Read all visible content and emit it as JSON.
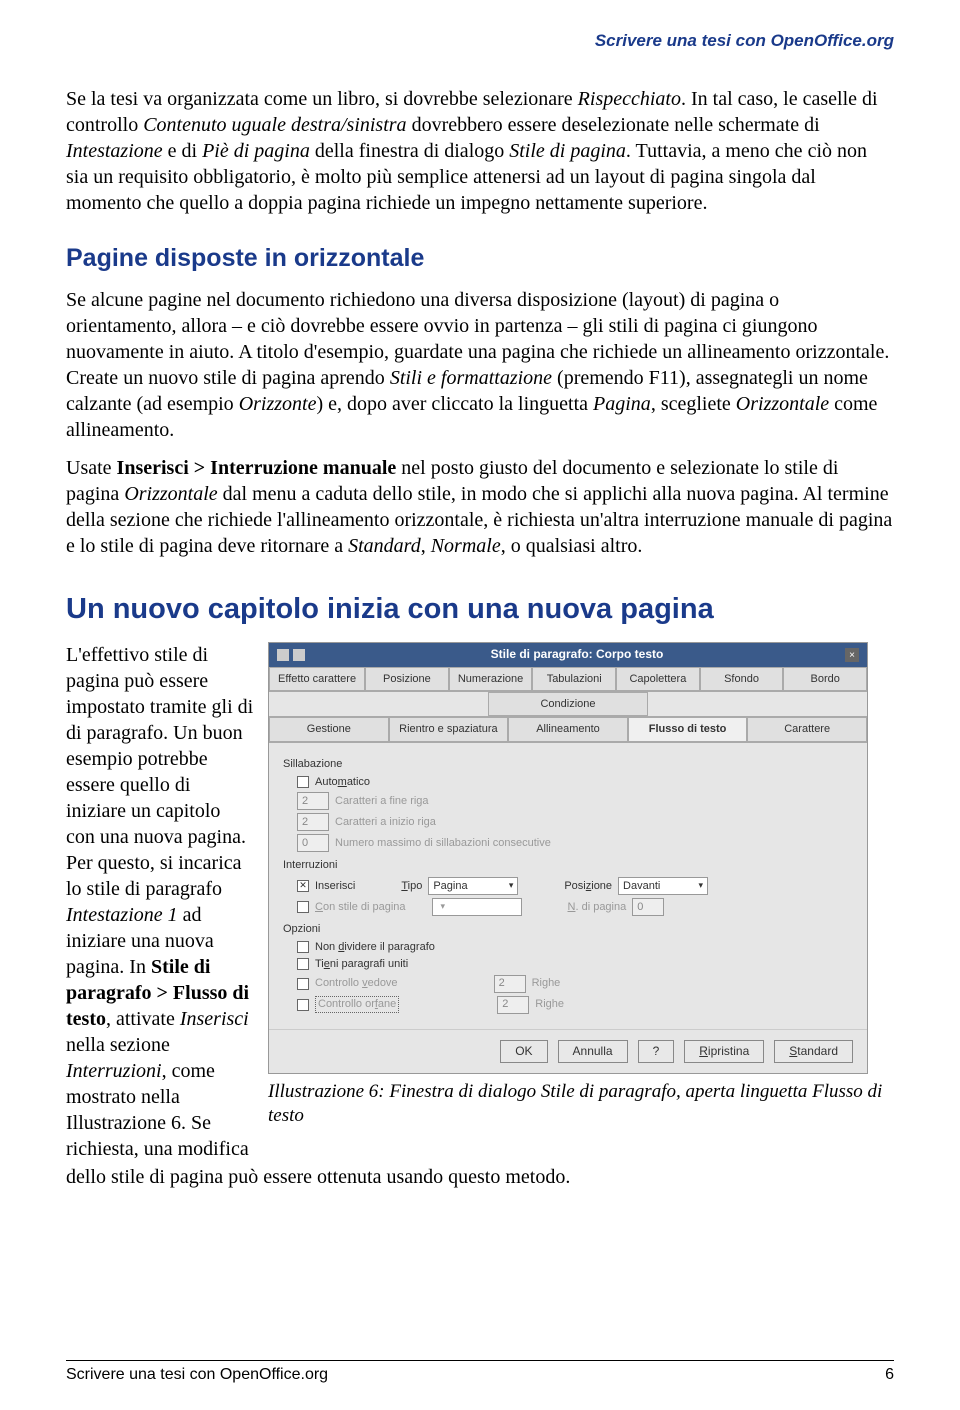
{
  "header": "Scrivere una tesi con OpenOffice.org",
  "p1a": "Se la tesi va organizzata come un libro, si dovrebbe selezionare ",
  "p1b": "Rispecchiato",
  "p1c": ". In tal caso, le caselle di controllo ",
  "p1d": "Contenuto uguale destra/sinistra",
  "p1e": " dovrebbero essere deselezionate nelle schermate di ",
  "p1f": "Intestazione",
  "p1g": " e di ",
  "p1h": "Piè di pagina",
  "p1i": " della finestra di dialogo ",
  "p1j": "Stile di pagina",
  "p1k": ". Tuttavia, a meno che ciò non sia  un requisito obbligatorio, è molto più semplice attenersi ad un layout di pagina singola dal momento che quello a doppia pagina richiede un impegno nettamente superiore.",
  "h2": "Pagine disposte in orizzontale",
  "p2a": "Se alcune pagine nel documento richiedono una diversa disposizione (layout) di pagina o orientamento, allora – e ciò dovrebbe essere ovvio in partenza – gli stili di pagina ci giungono nuovamente in aiuto. A titolo d'esempio, guardate una pagina che richiede un allineamento orizzontale. Create un nuovo stile di pagina aprendo ",
  "p2b": "Stili e formattazione",
  "p2c": " (premendo F11), assegnategli un nome calzante (ad esempio ",
  "p2d": "Orizzonte",
  "p2e": ") e, dopo aver cliccato la linguetta ",
  "p2f": "Pagina",
  "p2g": ", scegliete ",
  "p2h": "Orizzontale",
  "p2i": " come allineamento.",
  "p3a": "Usate ",
  "p3b": "Inserisci > Interruzione manuale",
  "p3c": " nel posto giusto del documento e selezionate lo stile di pagina ",
  "p3d": "Orizzontale",
  "p3e": " dal menu a caduta dello stile, in modo che si applichi alla nuova pagina. Al termine della sezione che richiede l'allineamento orizzontale, è richiesta un'altra interruzione manuale di pagina e lo stile di pagina deve ritornare a ",
  "p3f": "Standard",
  "p3g": ", ",
  "p3h": "Normale",
  "p3i": ", o qualsiasi altro.",
  "h1": "Un nuovo capitolo inizia con una nuova pagina",
  "leftcol_a": "L'effettivo stile di pagina può essere impostato tramite gli di di paragrafo. Un buon esempio potrebbe essere quello di iniziare un capitolo con una nuova pagina. Per questo,  si incarica lo stile di paragrafo ",
  "leftcol_b": "Intestazione 1",
  "leftcol_c": " ad iniziare una nuova pagina. In ",
  "leftcol_d": "Stile di paragrafo > Flusso di testo",
  "leftcol_e": ", attivate ",
  "leftcol_f": "Inserisci",
  "leftcol_g": " nella sezione ",
  "leftcol_h": "Interruzioni",
  "leftcol_i": ", come mostrato nella Illustrazione 6.  Se richiesta, una modifica",
  "after": "dello stile di pagina può essere ottenuta usando questo metodo.",
  "dialog": {
    "title": "Stile di paragrafo: Corpo testo",
    "tabs_row1": [
      "Effetto carattere",
      "Posizione",
      "Numerazione",
      "Tabulazioni",
      "Capolettera",
      "Sfondo",
      "Bordo"
    ],
    "tabs_row2_a": "Condizione",
    "tabs_row3": [
      "Gestione",
      "Rientro e spaziatura",
      "Allineamento",
      "Flusso di testo",
      "Carattere"
    ],
    "grp_sill": "Sillabazione",
    "auto": "Automatico",
    "cfr": "Caratteri a fine riga",
    "cir": "Caratteri a inizio riga",
    "nms": "Numero massimo di sillabazioni consecutive",
    "grp_int": "Interruzioni",
    "ins": "Inserisci",
    "tipo": "Tipo",
    "tipo_val": "Pagina",
    "pos": "Posizione",
    "pos_val": "Davanti",
    "csp": "Con stile di pagina",
    "ndp": "N. di pagina",
    "ndp_val": "0",
    "grp_opz": "Opzioni",
    "ndiv": "Non dividere il paragrafo",
    "tieni": "Tieni paragrafi uniti",
    "cved": "Controllo vedove",
    "corf": "Controllo orfane",
    "righe": "Righe",
    "val2": "2",
    "btn_ok": "OK",
    "btn_ann": "Annulla",
    "btn_help": "?",
    "btn_rip": "Ripristina",
    "btn_std": "Standard"
  },
  "caption": "Illustrazione 6: Finestra di dialogo Stile di paragrafo, aperta linguetta Flusso di testo",
  "footer_left": "Scrivere una tesi con OpenOffice.org",
  "footer_right": "6"
}
